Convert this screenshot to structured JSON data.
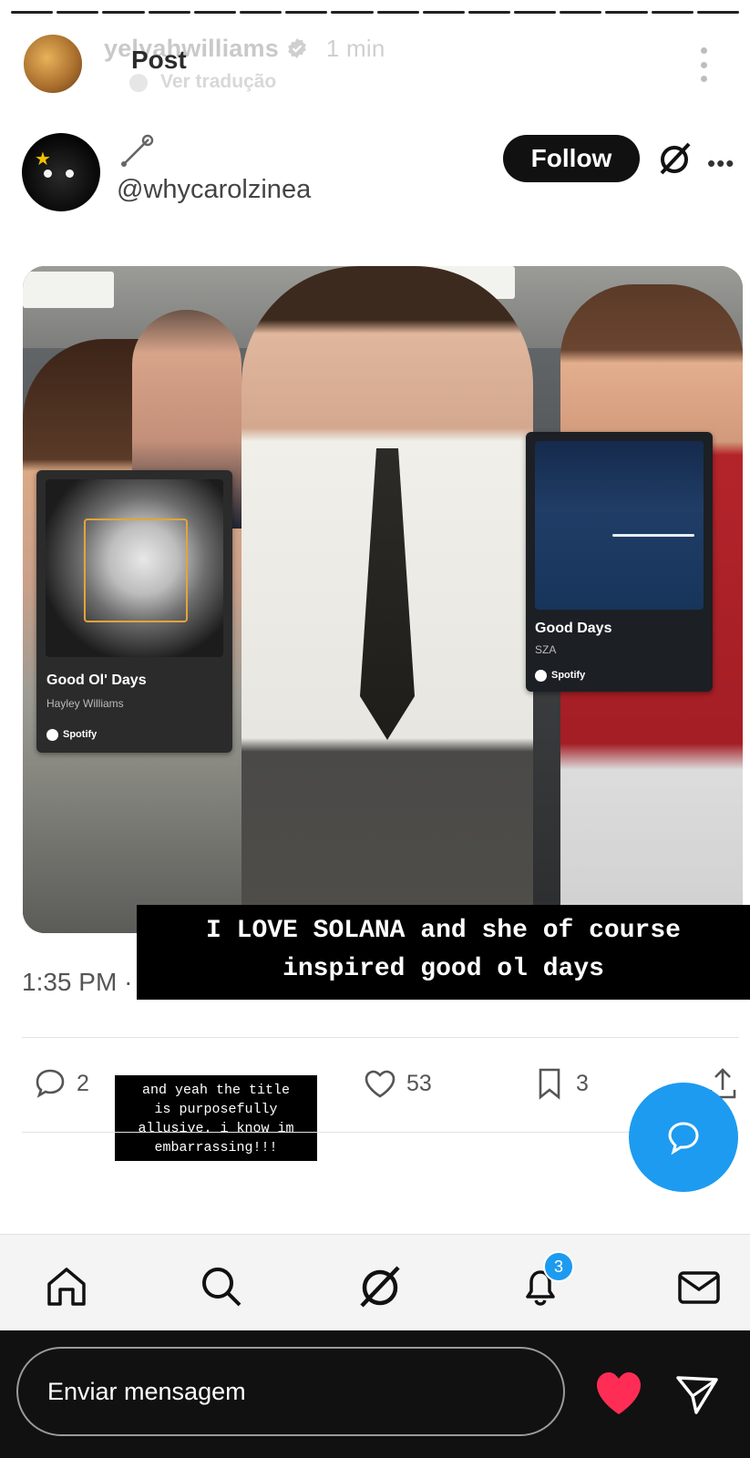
{
  "story": {
    "username": "yelyahwilliams",
    "time": "1 min",
    "overlay_title": "Post",
    "translate_label": "Ver tradução",
    "progress_segments": 16,
    "progress_current": 16
  },
  "tweet": {
    "handle": "@whycarolzinea",
    "follow_label": "Follow",
    "more_label": "•••",
    "time": "1:35 PM",
    "time_suffix": "·",
    "replies": "2",
    "likes": "53",
    "bookmarks": "3"
  },
  "cards": [
    {
      "title": "Good Ol' Days",
      "artist": "Hayley Williams",
      "brand": "Spotify"
    },
    {
      "title": "Good Days",
      "artist": "SZA",
      "brand": "Spotify"
    }
  ],
  "caption": {
    "line1": "I LOVE SOLANA and she of course",
    "line2": "inspired good ol days"
  },
  "sticker": {
    "line1": "and yeah the title",
    "line2": "is purposefully",
    "line3": "allusive. i know im",
    "line4": "embarrassing!!!"
  },
  "tabbar": {
    "notifications_badge": "3"
  },
  "composer": {
    "placeholder": "Enviar mensagem"
  },
  "colors": {
    "accent": "#1d9bf0",
    "heart": "#ff2d55",
    "follow_bg": "#111111"
  }
}
